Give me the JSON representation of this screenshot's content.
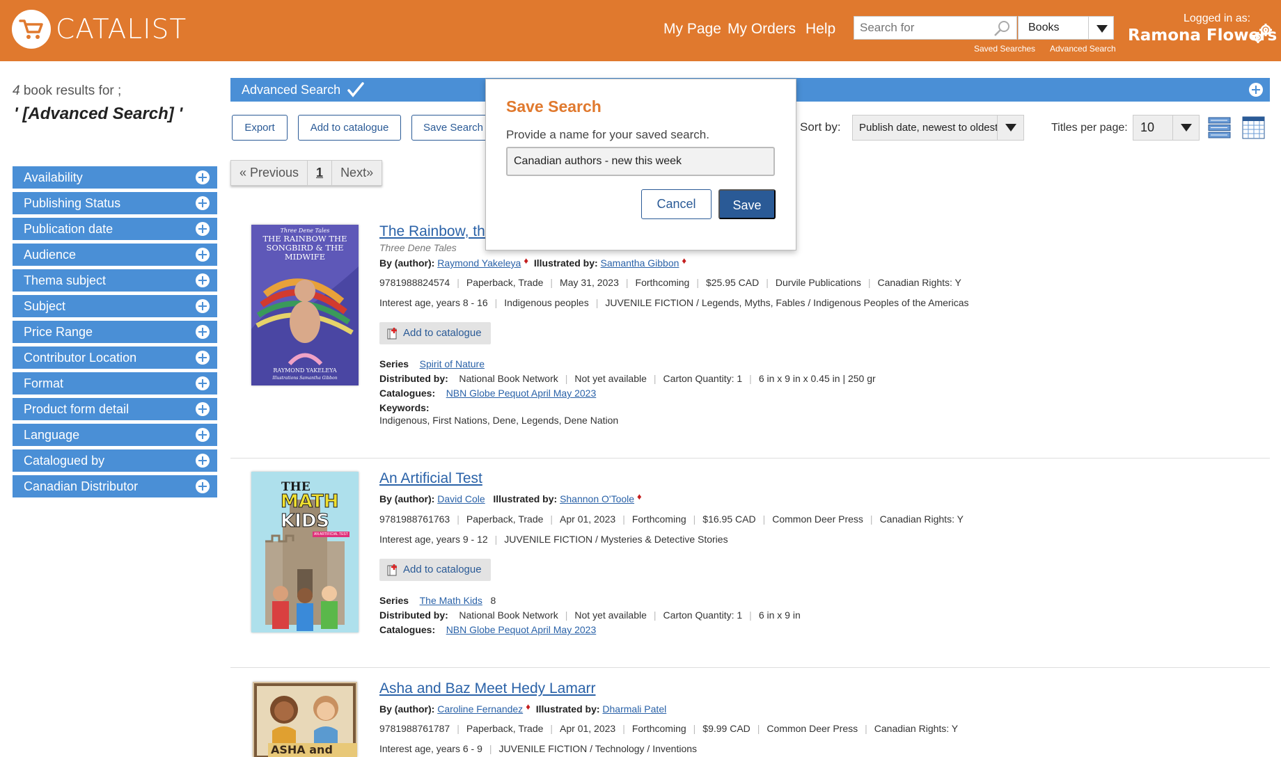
{
  "header": {
    "brand": "CATALIST",
    "nav": [
      "My Page",
      "My Orders",
      "Help"
    ],
    "search_placeholder": "Search for",
    "search_type": "Books",
    "saved_searches": "Saved Searches",
    "advanced_search": "Advanced Search",
    "logged_in_label": "Logged in as:",
    "user_name": "Ramona Flowers",
    "color": "#e0792e"
  },
  "sidebar": {
    "count": "4",
    "count_suffix": " book results for ;",
    "query": "' [Advanced Search] '",
    "facets": [
      "Availability",
      "Publishing Status",
      "Publication date",
      "Audience",
      "Thema subject",
      "Subject",
      "Price Range",
      "Contributor Location",
      "Format",
      "Product form detail",
      "Language",
      "Catalogued by",
      "Canadian Distributor"
    ]
  },
  "toolbar": {
    "adv_search": "Advanced Search",
    "export": "Export",
    "add_to_catalogue": "Add to catalogue",
    "save_search": "Save Search",
    "sort_label": "Sort by:",
    "sort_value": "Publish date, newest to oldest",
    "tpp_label": "Titles per page:",
    "tpp_value": "10"
  },
  "pager": {
    "prev": "« Previous",
    "page": "1",
    "next": "Next»"
  },
  "modal": {
    "title": "Save Search",
    "prompt": "Provide a name for your saved search.",
    "value": "Canadian authors - new this week",
    "cancel": "Cancel",
    "save": "Save"
  },
  "books": [
    {
      "title": "The Rainbow, the",
      "subtitle": "Three Dene Tales",
      "author_label": "By (author):",
      "author": "Raymond Yakeleya",
      "illus_label": "Illustrated by:",
      "illustrator": "Samantha Gibbon",
      "isbn": "9781988824574",
      "format": "Paperback, Trade",
      "date": "May 31, 2023",
      "status": "Forthcoming",
      "price": "$25.95 CAD",
      "publisher": "Durvile Publications",
      "rights": "Canadian Rights: Y",
      "age": "Interest age, years 8 - 16",
      "audience": "Indigenous peoples",
      "subject": "JUVENILE FICTION / Legends, Myths, Fables / Indigenous Peoples of the Americas",
      "add": "Add to catalogue",
      "series_label": "Series",
      "series": "Spirit of Nature",
      "series_num": "",
      "dist_label": "Distributed by:",
      "distributor": "National Book Network",
      "avail": "Not yet available",
      "carton": "Carton Quantity: 1",
      "dims": "6 in x 9 in x 0.45 in | 250 gr",
      "cat_label": "Catalogues:",
      "catalogue": "NBN Globe Pequot April May 2023",
      "kw_label": "Keywords:",
      "keywords": "Indigenous, First Nations, Dene, Legends, Dene Nation",
      "cover_top": "Three Dene Tales",
      "cover_title": "THE RAINBOW THE SONGBIRD & THE MIDWIFE",
      "cover_author": "RAYMOND YAKELEYA",
      "cover_illus": "Illustrations Samantha Gibbon"
    },
    {
      "title": "An Artificial Test",
      "author_label": "By (author):",
      "author": "David Cole",
      "illus_label": "Illustrated by:",
      "illustrator": "Shannon O'Toole",
      "isbn": "9781988761763",
      "format": "Paperback, Trade",
      "date": "Apr 01, 2023",
      "status": "Forthcoming",
      "price": "$16.95 CAD",
      "publisher": "Common Deer Press",
      "rights": "Canadian Rights: Y",
      "age": "Interest age, years 9 - 12",
      "subject": "JUVENILE FICTION / Mysteries & Detective Stories",
      "add": "Add to catalogue",
      "series_label": "Series",
      "series": "The Math Kids",
      "series_num": "8",
      "dist_label": "Distributed by:",
      "distributor": "National Book Network",
      "avail": "Not yet available",
      "carton": "Carton Quantity: 1",
      "dims": "6 in x 9 in",
      "cat_label": "Catalogues:",
      "catalogue": "NBN Globe Pequot April May 2023",
      "cover_title_1": "THE",
      "cover_title_2": "MATH",
      "cover_title_3": "KIDS",
      "cover_sub": "AN ARTIFICIAL TEST"
    },
    {
      "title": "Asha and Baz Meet Hedy Lamarr",
      "author_label": "By (author):",
      "author": "Caroline Fernandez",
      "illus_label": "Illustrated by:",
      "illustrator": "Dharmali Patel",
      "isbn": "9781988761787",
      "format": "Paperback, Trade",
      "date": "Apr 01, 2023",
      "status": "Forthcoming",
      "price": "$9.99 CAD",
      "publisher": "Common Deer Press",
      "rights": "Canadian Rights: Y",
      "age": "Interest age, years 6 - 9",
      "subject": "JUVENILE FICTION / Technology / Inventions",
      "cover_title": "ASHA and BAZ"
    }
  ]
}
